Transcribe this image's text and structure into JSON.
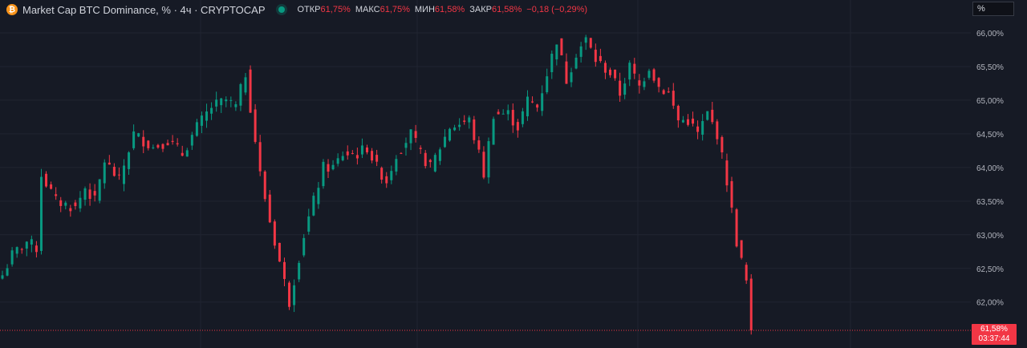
{
  "header": {
    "title": "Market Cap BTC Dominance, % · 4ч · CRYPTOCAP",
    "coin_icon": "bitcoin-icon",
    "ohlc": {
      "open_label": "ОТКР",
      "open_value": "61,75%",
      "high_label": "МАКС",
      "high_value": "61,75%",
      "low_label": "МИН",
      "low_value": "61,58%",
      "close_label": "ЗАКР",
      "close_value": "61,58%",
      "change": "−0,18 (−0,29%)"
    }
  },
  "axis_box": {
    "label": "%"
  },
  "price_tag": {
    "price": "61,58%",
    "countdown": "03:37:44"
  },
  "colors": {
    "background": "#161a25",
    "up": "#089981",
    "down": "#f23645",
    "grid": "#202431",
    "axis_text": "#b2b5be",
    "brand": "#f7931a"
  },
  "chart_data": {
    "type": "candlestick",
    "title": "Market Cap BTC Dominance, % · 4ч · CRYPTOCAP",
    "ylabel": "%",
    "ylim": [
      61.55,
      66.05
    ],
    "y_ticks": [
      62.0,
      62.5,
      63.0,
      63.5,
      64.0,
      64.5,
      65.0,
      65.5,
      66.0
    ],
    "y_tick_labels": [
      "62,00%",
      "62,50%",
      "63,00%",
      "63,50%",
      "64,00%",
      "64,50%",
      "65,00%",
      "65,50%",
      "66,00%"
    ],
    "last_price": 61.58,
    "grid": true,
    "close_path": [
      [
        0,
        62.4
      ],
      [
        2,
        62.7
      ],
      [
        5,
        62.9
      ],
      [
        7,
        62.8
      ],
      [
        8,
        63.9
      ],
      [
        11,
        63.5
      ],
      [
        15,
        63.4
      ],
      [
        17,
        63.7
      ],
      [
        19,
        63.5
      ],
      [
        21,
        64.1
      ],
      [
        24,
        63.8
      ],
      [
        27,
        64.5
      ],
      [
        31,
        64.3
      ],
      [
        34,
        64.4
      ],
      [
        37,
        64.2
      ],
      [
        40,
        64.6
      ],
      [
        43,
        64.9
      ],
      [
        46,
        65.0
      ],
      [
        48,
        64.9
      ],
      [
        50,
        65.4
      ],
      [
        53,
        63.9
      ],
      [
        55,
        63.2
      ],
      [
        57,
        62.6
      ],
      [
        59,
        62.0
      ],
      [
        62,
        63.0
      ],
      [
        64,
        63.5
      ],
      [
        66,
        64.0
      ],
      [
        68,
        64.0
      ],
      [
        70,
        64.2
      ],
      [
        73,
        64.2
      ],
      [
        75,
        64.3
      ],
      [
        77,
        64.0
      ],
      [
        79,
        63.8
      ],
      [
        81,
        64.2
      ],
      [
        84,
        64.5
      ],
      [
        86,
        64.2
      ],
      [
        88,
        64.0
      ],
      [
        90,
        64.3
      ],
      [
        92,
        64.6
      ],
      [
        96,
        64.7
      ],
      [
        98,
        64.2
      ],
      [
        99,
        63.9
      ],
      [
        101,
        64.8
      ],
      [
        104,
        64.8
      ],
      [
        106,
        64.6
      ],
      [
        108,
        65.0
      ],
      [
        110,
        64.9
      ],
      [
        112,
        65.4
      ],
      [
        114,
        65.9
      ],
      [
        116,
        65.3
      ],
      [
        118,
        65.7
      ],
      [
        120,
        65.9
      ],
      [
        122,
        65.6
      ],
      [
        125,
        65.4
      ],
      [
        127,
        65.1
      ],
      [
        129,
        65.5
      ],
      [
        131,
        65.2
      ],
      [
        133,
        65.5
      ],
      [
        135,
        65.2
      ],
      [
        137,
        65.1
      ],
      [
        139,
        64.7
      ],
      [
        141,
        64.7
      ],
      [
        143,
        64.5
      ],
      [
        145,
        64.8
      ],
      [
        147,
        64.5
      ],
      [
        149,
        63.8
      ],
      [
        151,
        62.9
      ],
      [
        153,
        62.3
      ],
      [
        154,
        61.58
      ]
    ]
  }
}
